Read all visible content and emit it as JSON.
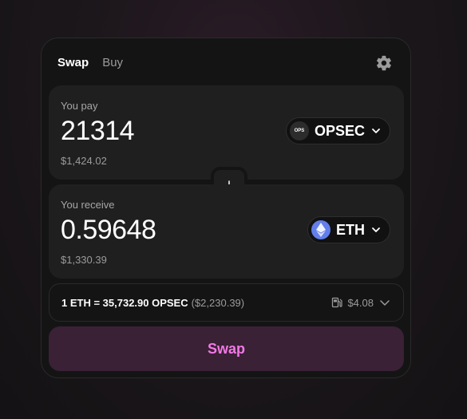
{
  "tabs": [
    {
      "label": "Swap",
      "active": true
    },
    {
      "label": "Buy",
      "active": false
    }
  ],
  "icons": {
    "settings": "gear-icon",
    "flip": "arrow-down-icon",
    "chevron": "chevron-down-icon",
    "gas": "gas-pump-icon"
  },
  "pay": {
    "label": "You pay",
    "amount": "21314",
    "usd": "$1,424.02",
    "token": {
      "symbol": "OPSEC",
      "icon_text": "OPS"
    }
  },
  "receive": {
    "label": "You receive",
    "amount": "0.59648",
    "usd": "$1,330.39",
    "token": {
      "symbol": "ETH"
    }
  },
  "rate": {
    "text": "1 ETH = 35,732.90 OPSEC",
    "usd": "($2,230.39)",
    "gas": "$4.08"
  },
  "swap_button": {
    "label": "Swap"
  },
  "colors": {
    "accent": "#f279e6",
    "swap_bg": "#3a2136",
    "eth_blue": "#627eea"
  }
}
